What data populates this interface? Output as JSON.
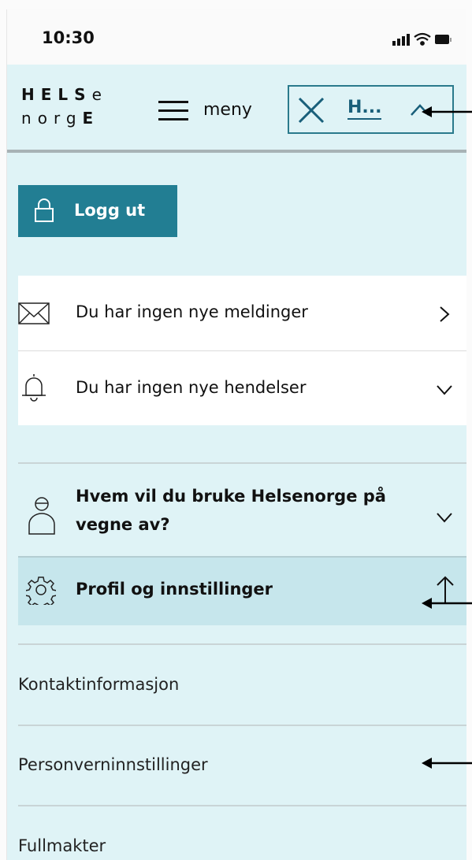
{
  "status_bar": {
    "time": "10:30"
  },
  "header": {
    "logo_top": [
      "H",
      "E",
      "L",
      "S",
      "e"
    ],
    "logo_bottom": [
      "n",
      "o",
      "r",
      "g",
      "E"
    ],
    "menu_label": "meny",
    "search_text": "H..."
  },
  "logout": {
    "label": "Logg ut"
  },
  "notifications": {
    "messages": "Du har ingen nye meldinger",
    "events": "Du har ingen nye hendelser"
  },
  "represent": {
    "line1": "Hvem vil du bruke Helsenorge på",
    "line2": "vegne av?"
  },
  "profile": {
    "label": "Profil og innstillinger"
  },
  "submenu": {
    "items": [
      "Kontaktinformasjon",
      "Personverninnstillinger",
      "Fullmakter"
    ]
  },
  "icons": {
    "lock": "lock-icon",
    "envelope": "envelope-icon",
    "bell": "bell-icon",
    "person": "person-icon",
    "gear": "gear-icon"
  },
  "colors": {
    "background": "#dff3f6",
    "accent": "#227e93",
    "selected_row": "#c6e6ec",
    "link": "#195f7a"
  }
}
